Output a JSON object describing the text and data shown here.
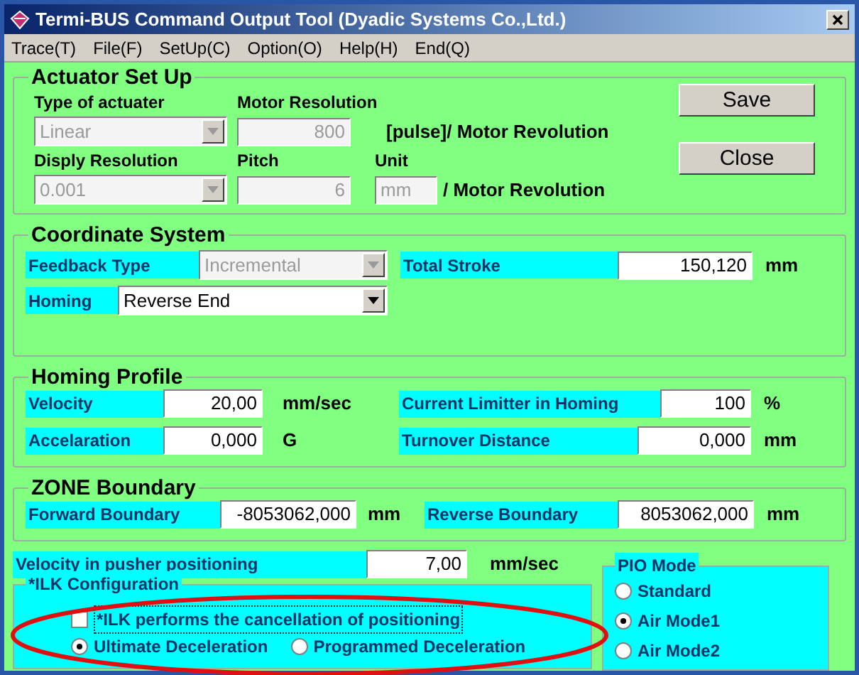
{
  "window": {
    "title": "Termi-BUS Command Output Tool (Dyadic Systems Co.,Ltd.)"
  },
  "menu": [
    {
      "label": "Trace(T)"
    },
    {
      "label": "File(F)"
    },
    {
      "label": "SetUp(C)"
    },
    {
      "label": "Option(O)"
    },
    {
      "label": "Help(H)"
    },
    {
      "label": "End(Q)"
    }
  ],
  "actuator_setup": {
    "title": "Actuator Set Up",
    "type_of_actuator": {
      "label": "Type of actuater",
      "value": "Linear",
      "disabled": true
    },
    "motor_resolution": {
      "label": "Motor Resolution",
      "value": "800",
      "disabled": true,
      "unit": "[pulse]/ Motor Revolution"
    },
    "display_resolution": {
      "label": "Disply Resolution",
      "value": "0.001",
      "disabled": true
    },
    "pitch": {
      "label": "Pitch",
      "value": "6",
      "disabled": true
    },
    "unit": {
      "label": "Unit",
      "value": "mm",
      "disabled": true,
      "suffix": "/ Motor Revolution"
    }
  },
  "buttons": [
    {
      "label": "Save"
    },
    {
      "label": "Close"
    }
  ],
  "coordinate_system": {
    "title": "Coordinate System",
    "feedback_type": {
      "label": "Feedback Type",
      "value": "Incremental",
      "disabled": true
    },
    "total_stroke": {
      "label": "Total Stroke",
      "value": "150,120",
      "unit": "mm"
    },
    "homing": {
      "label": "Homing",
      "value": "Reverse End",
      "disabled": false
    }
  },
  "homing_profile": {
    "title": "Homing Profile",
    "velocity": {
      "label": "Velocity",
      "value": "20,00",
      "unit": "mm/sec"
    },
    "current_limiter": {
      "label": "Current Limitter in Homing",
      "value": "100",
      "unit": "%"
    },
    "acceleration": {
      "label": "Accelaration",
      "value": "0,000",
      "unit": "G"
    },
    "turnover_distance": {
      "label": "Turnover Distance",
      "value": "0,000",
      "unit": "mm"
    }
  },
  "zone_boundary": {
    "title": "ZONE Boundary",
    "forward": {
      "label": "Forward Boundary",
      "value": "-8053062,000",
      "unit": "mm"
    },
    "reverse": {
      "label": "Reverse Boundary",
      "value": "8053062,000",
      "unit": "mm"
    }
  },
  "pusher_velocity": {
    "label": "Velocity in pusher positioning",
    "value": "7,00",
    "unit": "mm/sec"
  },
  "ilk_configuration": {
    "title": "*ILK Configuration",
    "checkbox": {
      "label": "*ILK performs the cancellation of positioning",
      "checked": false
    },
    "options": [
      {
        "label": "Ultimate Deceleration",
        "selected": true
      },
      {
        "label": "Programmed Deceleration",
        "selected": false
      }
    ]
  },
  "pio_mode": {
    "title": "PIO Mode",
    "options": [
      {
        "label": "Standard",
        "selected": false
      },
      {
        "label": "Air Mode1",
        "selected": true
      },
      {
        "label": "Air Mode2",
        "selected": false
      }
    ]
  }
}
